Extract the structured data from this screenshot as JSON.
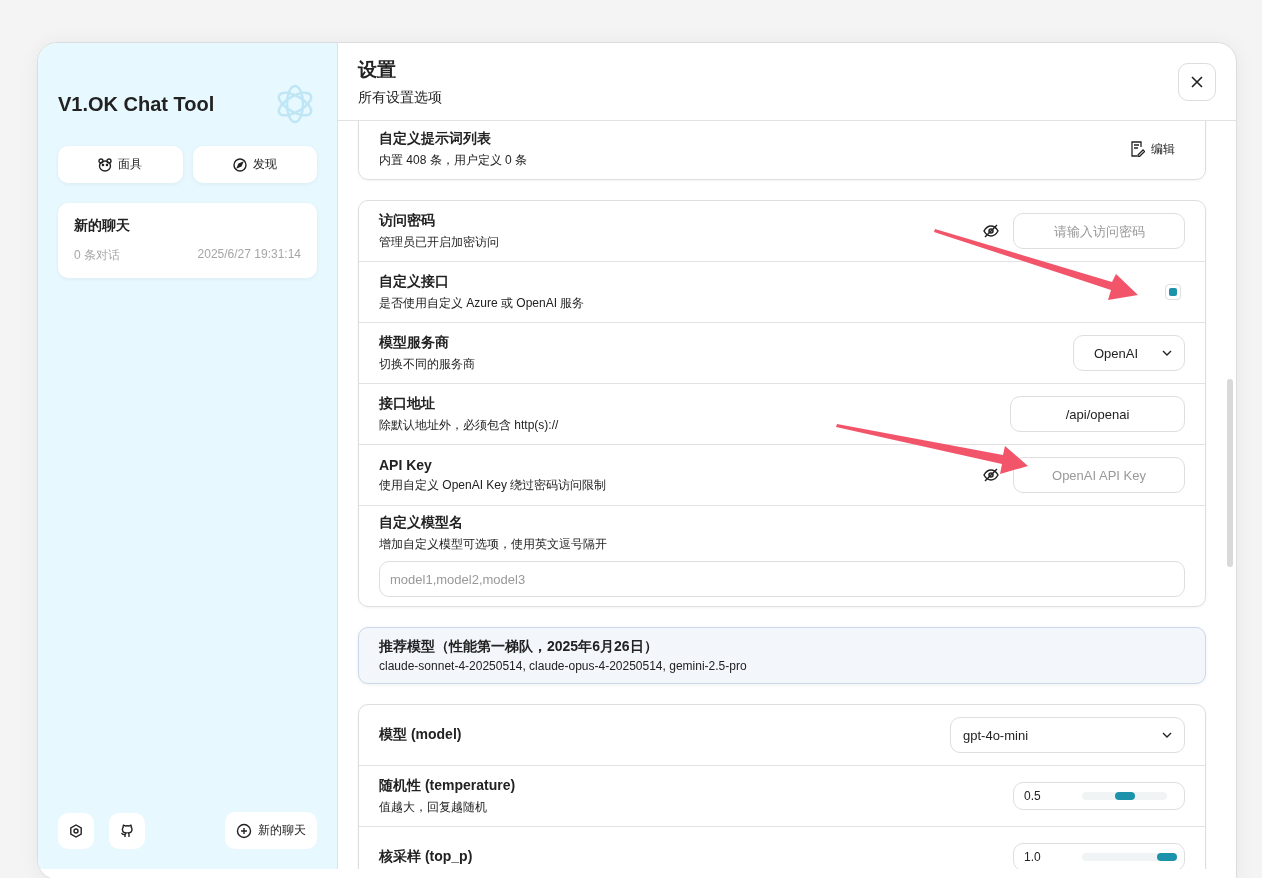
{
  "sidebar": {
    "title": "V1.OK Chat Tool",
    "buttons": [
      {
        "kind": "mask",
        "label": "面具"
      },
      {
        "kind": "discover",
        "label": "发现"
      }
    ],
    "chats": [
      {
        "title": "新的聊天",
        "count": "0 条对话",
        "time": "2025/6/27 19:31:14"
      }
    ],
    "new_chat": "新的聊天"
  },
  "settings": {
    "title": "设置",
    "subtitle": "所有设置选项",
    "prompt_card": {
      "title": "自定义提示词列表",
      "desc": "内置 408 条，用户定义 0 条",
      "action": "编辑"
    },
    "access_rows": [
      {
        "kind": "password",
        "title": "访问密码",
        "desc": "管理员已开启加密访问",
        "placeholder": "请输入访问密码"
      },
      {
        "kind": "checkbox",
        "title": "自定义接口",
        "desc": "是否使用自定义 Azure 或 OpenAI 服务",
        "checked": true
      },
      {
        "kind": "select",
        "title": "模型服务商",
        "desc": "切换不同的服务商",
        "value": "OpenAI"
      },
      {
        "kind": "input",
        "title": "接口地址",
        "desc": "除默认地址外，必须包含 http(s)://",
        "value": "/api/openai"
      },
      {
        "kind": "password",
        "title": "API Key",
        "desc": "使用自定义 OpenAI Key 绕过密码访问限制",
        "placeholder": "OpenAI API Key"
      },
      {
        "kind": "block",
        "title": "自定义模型名",
        "desc": "增加自定义模型可选项，使用英文逗号隔开",
        "placeholder": "model1,model2,model3"
      }
    ],
    "notice": {
      "title": "推荐模型（性能第一梯队，2025年6月26日）",
      "text": "claude-sonnet-4-20250514, claude-opus-4-20250514, gemini-2.5-pro"
    },
    "model_rows": [
      {
        "kind": "wide-select",
        "title": "模型 (model)",
        "value": "gpt-4o-mini"
      },
      {
        "kind": "slider",
        "title": "随机性 (temperature)",
        "desc": "值越大，回复越随机",
        "value": "0.5",
        "level": 0.5
      },
      {
        "kind": "slider",
        "title": "核采样 (top_p)",
        "value": "1.0",
        "level": 1.0
      }
    ]
  }
}
